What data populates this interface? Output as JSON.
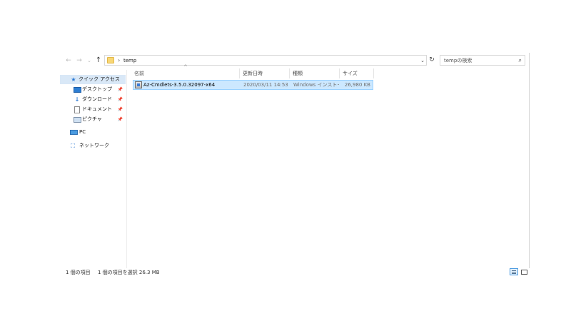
{
  "address": {
    "path": [
      "temp"
    ],
    "back_icon": "←",
    "forward_icon": "→",
    "recent_icon": "⌄",
    "up_icon": "↑",
    "dropdown_icon": "⌄",
    "separator": "›",
    "refresh_icon": "↻"
  },
  "search": {
    "placeholder": "tempの検索",
    "icon": "⌕"
  },
  "sidebar": {
    "items": [
      {
        "label": "クイック アクセス",
        "icon": "star-icon",
        "glyph": "★",
        "selected": true,
        "pinned": false
      },
      {
        "label": "デスクトップ",
        "icon": "desktop-icon",
        "glyph": "",
        "selected": false,
        "pinned": true
      },
      {
        "label": "ダウンロード",
        "icon": "download-icon",
        "glyph": "↓",
        "selected": false,
        "pinned": true
      },
      {
        "label": "ドキュメント",
        "icon": "document-icon",
        "glyph": "",
        "selected": false,
        "pinned": true
      },
      {
        "label": "ピクチャ",
        "icon": "picture-icon",
        "glyph": "",
        "selected": false,
        "pinned": true
      },
      {
        "label": "PC",
        "icon": "pc-icon",
        "glyph": "",
        "selected": false,
        "pinned": false
      },
      {
        "label": "ネットワーク",
        "icon": "network-icon",
        "glyph": "⛶",
        "selected": false,
        "pinned": false
      }
    ],
    "pin_glyph": "📌"
  },
  "columns": {
    "sort_indicator": "^",
    "name": "名前",
    "date": "更新日時",
    "type": "種類",
    "size": "サイズ"
  },
  "files": [
    {
      "name": "Az-Cmdlets-3.5.0.32097-x64",
      "date": "2020/03/11 14:53",
      "type": "Windows インストー...",
      "size": "26,980 KB",
      "icon": "installer-icon",
      "selected": true
    }
  ],
  "status": {
    "item_count": "1 個の項目",
    "selection": "1 個の項目を選択 26.3 MB"
  },
  "colors": {
    "selection_bg": "#cce8ff",
    "selection_border": "#99d1ff",
    "sidebar_selected": "#d9e8f7",
    "accent": "#2b79d4"
  }
}
